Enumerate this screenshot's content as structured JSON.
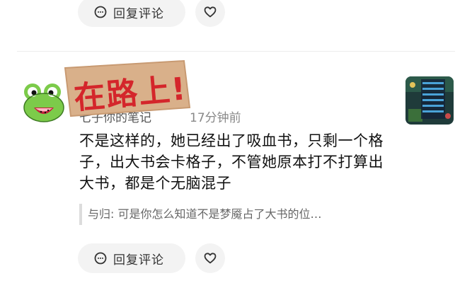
{
  "actions_top": {
    "reply_label": "回复评论",
    "like_icon": "heart-icon",
    "reply_icon": "comment-icon"
  },
  "comment": {
    "sticker_text": "在路上!",
    "username": "七子你的笔记",
    "timestamp": "17分钟前",
    "text": "不是这样的，她已经出了吸血书，只剩一个格子，出大书会卡格子，不管她原本打不打算出大书，都是个无脑混子",
    "quoted_reply": "与归: 可是你怎么知道不是梦魇占了大书的位…"
  },
  "actions_bottom": {
    "reply_label": "回复评论",
    "like_icon": "heart-icon",
    "reply_icon": "comment-icon"
  },
  "colors": {
    "pill_bg": "#f3f3f3",
    "sticker_bg": "#d9b08a",
    "sticker_text": "#d4262b",
    "avatar_green": "#7ccb4a"
  }
}
